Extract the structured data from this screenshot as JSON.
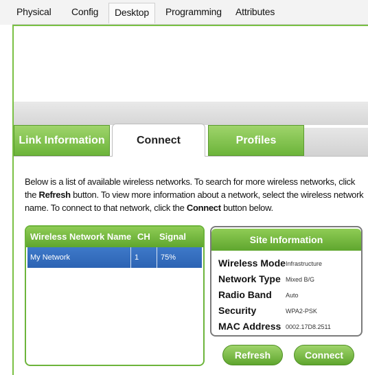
{
  "menu_tabs": [
    {
      "label": "Physical"
    },
    {
      "label": "Config"
    },
    {
      "label": "Desktop"
    },
    {
      "label": "Programming"
    },
    {
      "label": "Attributes"
    }
  ],
  "active_menu_tab": "Desktop",
  "wireless_tabs": [
    {
      "label": "Link Information"
    },
    {
      "label": "Connect"
    },
    {
      "label": "Profiles"
    }
  ],
  "active_wireless_tab": "Connect",
  "description": {
    "part1": "Below is a list of available wireless networks. To search for more wireless networks, click the ",
    "refresh_word": "Refresh",
    "part2": " button. To view more information about a network, select the wireless network name. To connect to that network, click the ",
    "connect_word": "Connect",
    "part3": " button below."
  },
  "networks": {
    "headers": {
      "name": "Wireless Network Name",
      "ch": "CH",
      "signal": "Signal"
    },
    "rows": [
      {
        "name": "My Network",
        "ch": "1",
        "signal": "75%"
      }
    ]
  },
  "site_info": {
    "title": "Site Information",
    "fields": [
      {
        "label": "Wireless Mode",
        "value": "Infrastructure"
      },
      {
        "label": "Network Type",
        "value": "Mixed B/G"
      },
      {
        "label": "Radio Band",
        "value": "Auto"
      },
      {
        "label": "Security",
        "value": "WPA2-PSK"
      },
      {
        "label": "MAC Address",
        "value": "0002.17D8.2511"
      }
    ]
  },
  "buttons": {
    "refresh": "Refresh",
    "connect": "Connect"
  },
  "colors": {
    "accent_green": "#79c043",
    "selection_blue": "#2f68b8"
  }
}
